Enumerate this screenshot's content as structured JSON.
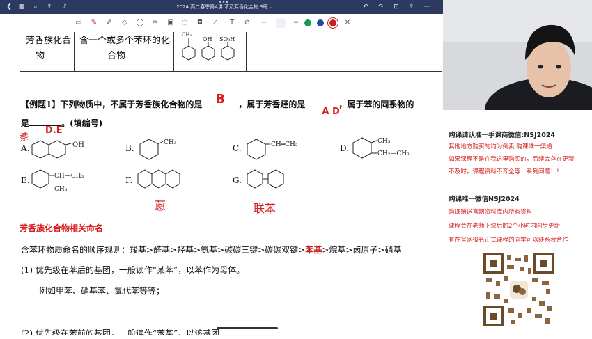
{
  "window": {
    "title": "2024 高二春季第4讲 苯及芳香化合物 S班 ⌄"
  },
  "colors": {
    "toolbar": "#2d3a5f",
    "accent_red": "#d62020",
    "pen_green": "#1a9b54",
    "pen_blue": "#1d4aa5",
    "pen_red": "#c42020"
  },
  "table": {
    "col1": [
      "芳香族化合",
      "物"
    ],
    "col2": [
      "含一个或多个苯环的化",
      "合物"
    ],
    "col3_labels": [
      "CH₃",
      "OH",
      "SO₃H"
    ]
  },
  "question": {
    "line1_a": "【例题1】下列物质中，不属于芳香族化合物的是",
    "blank1": "B",
    "line1_b": "，属于芳香烃的是",
    "blank2": "A D",
    "line1_c": "，属于苯的同系物的",
    "line2_a": "是",
    "blank3": "D.E",
    "line2_b": "。(填编号)",
    "options": {
      "A": {
        "label": "A.",
        "sub": "OH"
      },
      "B": {
        "label": "B.",
        "sub": "CH₃"
      },
      "C": {
        "label": "C.",
        "sub": "CH═CH₂"
      },
      "D": {
        "label": "D.",
        "sub1": "CH₃",
        "sub2": "CH₂—CH₃"
      },
      "E": {
        "label": "E.",
        "sub1": "CH—CH₃",
        "sub2": "CH₃"
      },
      "F": {
        "label": "F."
      },
      "G": {
        "label": "G."
      }
    },
    "handwriting": {
      "a_note": "萘",
      "f_note": "蒽",
      "g_note": "联苯",
      "d_note": "苯"
    }
  },
  "section": {
    "heading": "芳香族化合物相关命名",
    "rule_a": "含苯环物质命名的顺序规则：羧基>醛基>羟基>氨基>碳碳三键>碳碳双键>",
    "rule_hl": "苯基",
    "rule_b": ">烷基>卤原子>硝基",
    "item1": "(1)  优先级在苯后的基团，一般读作“某苯”，以苯作为母体。",
    "example": "例如甲苯、硝基苯、氯代苯等等；",
    "item2_partial": "(2)  优先级在苯前的基团，一般读作“苯某”，以该基团"
  },
  "panel": {
    "h1": "购课请认准一手课商微信:NSJ2024",
    "l1": "其他地方购买的均为倒卖,购课唯一渠道",
    "l2": "如果课程不是在我这里购买的，后续会存在更新",
    "l3": "不及时，课程资料不齐全等一系列问题！！",
    "h2": "购课唯一微信NSJ2024",
    "l4": "购课赠送官网资料库内所有资料",
    "l5": "课程会在老师下课后的2个小时内同步更新",
    "l6": "有在官网报名正式课程的同学可以联系我合作"
  },
  "icons": [
    "back-icon",
    "grid-icon",
    "search-icon",
    "share-icon",
    "mic-icon",
    "undo-icon",
    "redo-icon",
    "bookmark-icon",
    "export-icon",
    "more-icon"
  ]
}
